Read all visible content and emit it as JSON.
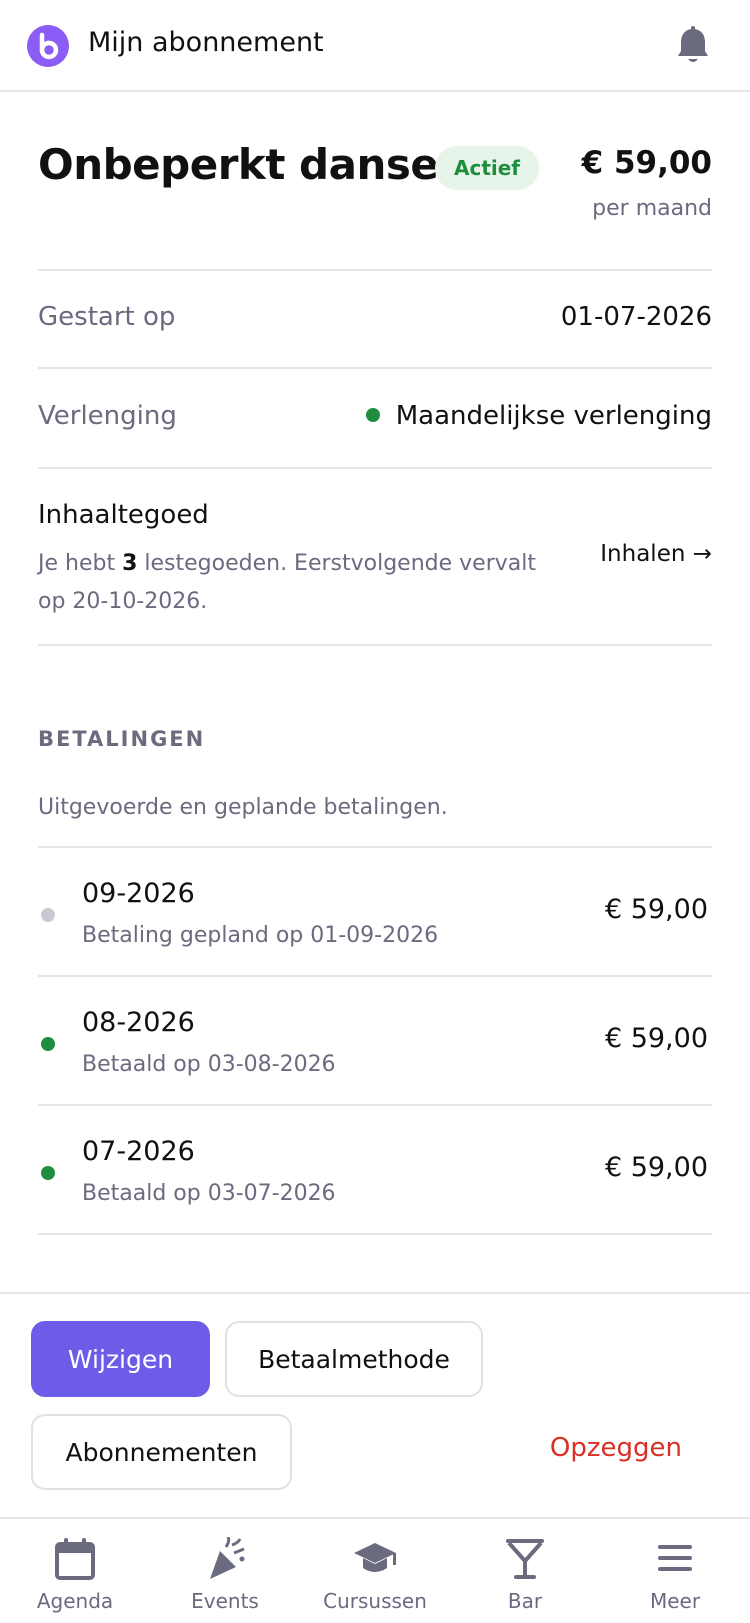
{
  "header": {
    "title": "Mijn abonnement"
  },
  "plan": {
    "name": "Onbeperkt dansen",
    "status": "Actief",
    "price": "€ 59,00",
    "period": "per maand"
  },
  "details": {
    "started_label": "Gestart op",
    "started_value": "01-07-2026",
    "renewal_label": "Verlenging",
    "renewal_value": "Maandelijkse verlenging"
  },
  "makeup": {
    "title": "Inhaaltegoed",
    "text_prefix": "Je hebt ",
    "credits": "3",
    "text_suffix": " lestegoeden. Eerstvolgende vervalt op 20-10-2026.",
    "action": "Inhalen →"
  },
  "payments": {
    "heading": "BETALINGEN",
    "subtitle": "Uitgevoerde en geplande betalingen.",
    "items": [
      {
        "period": "09-2026",
        "description": "Betaling gepland op 01-09-2026",
        "amount": "€ 59,00",
        "status": "planned"
      },
      {
        "period": "08-2026",
        "description": "Betaald op 03-08-2026",
        "amount": "€ 59,00",
        "status": "paid"
      },
      {
        "period": "07-2026",
        "description": "Betaald op 03-07-2026",
        "amount": "€ 59,00",
        "status": "paid"
      }
    ]
  },
  "actions": {
    "change": "Wijzigen",
    "payment_method": "Betaalmethode",
    "subscriptions": "Abonnementen",
    "cancel": "Opzeggen"
  },
  "tabs": [
    {
      "label": "Agenda",
      "icon": "calendar-icon"
    },
    {
      "label": "Events",
      "icon": "party-popper-icon"
    },
    {
      "label": "Cursussen",
      "icon": "graduation-cap-icon"
    },
    {
      "label": "Bar",
      "icon": "cocktail-icon"
    },
    {
      "label": "Meer",
      "icon": "menu-icon"
    }
  ],
  "colors": {
    "accent": "#6c5ce7",
    "logo": "#8b5cf6",
    "success": "#1e8e3e",
    "danger": "#d93025",
    "muted": "#6b6b80"
  }
}
